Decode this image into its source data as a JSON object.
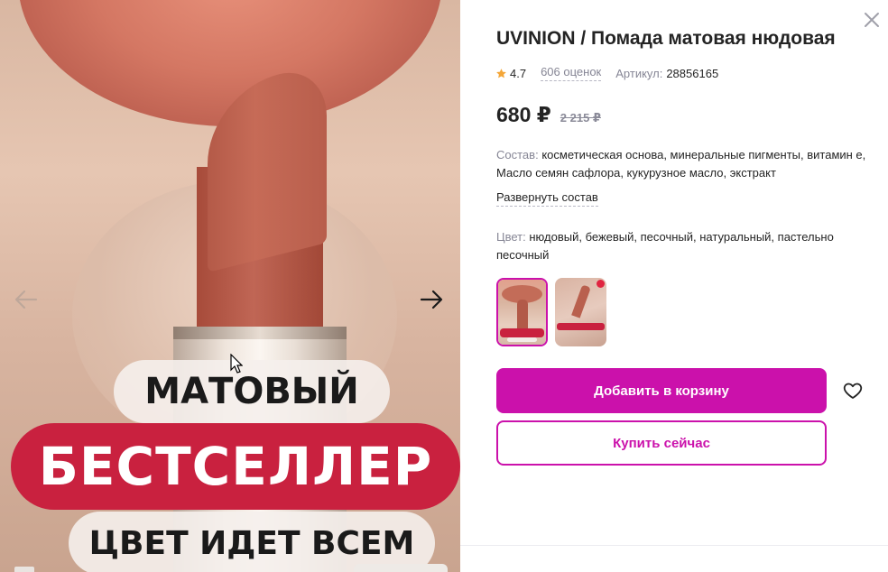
{
  "gallery": {
    "banner": {
      "line1": "МАТОВЫЙ",
      "line2": "БЕСТСЕЛЛЕР",
      "line3": "ЦВЕТ ИДЕТ ВСЕМ"
    }
  },
  "product": {
    "title": "UVINION / Помада матовая нюдовая",
    "rating": "4.7",
    "reviews": "606 оценок",
    "sku_label": "Артикул:",
    "sku": "28856165",
    "price_now": "680 ₽",
    "price_old": "2 215 ₽",
    "composition_label": "Состав:",
    "composition": "косметическая основа, минеральные пигменты, витамин е, Масло семян сафлора, кукурузное масло, экстракт",
    "expand_label": "Развернуть состав",
    "color_label": "Цвет:",
    "color": "нюдовый, бежевый, песочный, натуральный, пастельно песочный"
  },
  "actions": {
    "add_to_cart": "Добавить в корзину",
    "buy_now": "Купить сейчас"
  },
  "colors": {
    "accent": "#cb11ab",
    "banner_red": "#c9213f",
    "star": "#f4a638"
  },
  "icons": {
    "close": "close-icon",
    "prev": "arrow-left-icon",
    "next": "arrow-right-icon",
    "favorite": "heart-icon",
    "rating": "star-icon"
  }
}
